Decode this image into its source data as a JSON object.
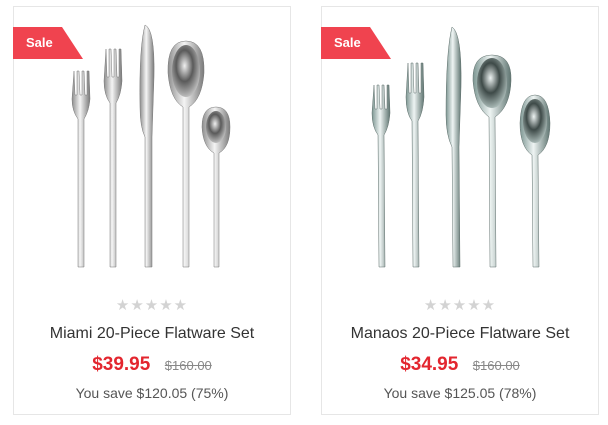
{
  "products": [
    {
      "badge": "Sale",
      "image_icon": "cutlery-set-icon",
      "rating": 0,
      "rating_stars": "★★★★★",
      "title": "Miami 20-Piece Flatware Set",
      "price": "$39.95",
      "old_price": "$160.00",
      "savings": "You save $120.05 (75%)"
    },
    {
      "badge": "Sale",
      "image_icon": "cutlery-set-icon",
      "rating": 0,
      "rating_stars": "★★★★★",
      "title": "Manaos 20-Piece Flatware Set",
      "price": "$34.95",
      "old_price": "$160.00",
      "savings": "You save $125.05 (78%)"
    }
  ],
  "colors": {
    "sale_badge": "#f0434f",
    "price": "#e3262f",
    "star_empty": "#d3d3d3"
  }
}
